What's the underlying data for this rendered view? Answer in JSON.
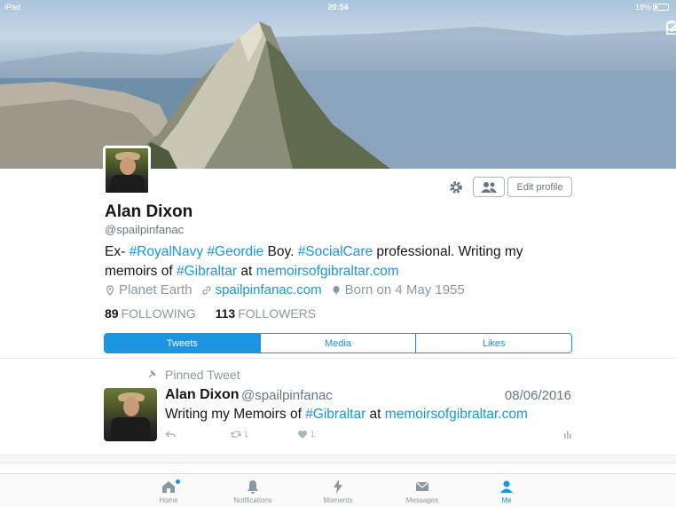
{
  "status_bar": {
    "device": "iPad",
    "time": "20:54",
    "battery": "18%"
  },
  "header": {
    "search_icon": "search-icon",
    "compose_icon": "compose-icon"
  },
  "profile": {
    "name": "Alan Dixon",
    "handle": "@spailpinfanac",
    "bio": {
      "p1": "Ex- ",
      "t1": "#RoyalNavy",
      "p2": " ",
      "t2": "#Geordie",
      "p3": " Boy. ",
      "t3": "#SocialCare",
      "p4": " professional. Writing my memoirs of ",
      "t4": "#Gibraltar",
      "p5": " at ",
      "t5": "memoirsofgibraltar.com"
    },
    "location": "Planet Earth",
    "website": "spailpinfanac.com",
    "born": "Born on 4 May 1955",
    "following_count": "89",
    "following_label": "FOLLOWING",
    "followers_count": "113",
    "followers_label": "FOLLOWERS",
    "edit_label": "Edit profile"
  },
  "tabs": [
    {
      "label": "Tweets",
      "active": true
    },
    {
      "label": "Media",
      "active": false
    },
    {
      "label": "Likes",
      "active": false
    }
  ],
  "tweet": {
    "pinned_label": "Pinned Tweet",
    "name": "Alan Dixon",
    "handle": "@spailpinfanac",
    "date": "08/06/2016",
    "text_prefix": "Writing my Memoirs of ",
    "text_tag": "#Gibraltar",
    "text_mid": " at ",
    "text_link": "memoirsofgibraltar.com",
    "retweets": "1",
    "likes": "1"
  },
  "tabbar": [
    {
      "label": "Home",
      "icon": "home-icon"
    },
    {
      "label": "Notifications",
      "icon": "bell-icon"
    },
    {
      "label": "Moments",
      "icon": "lightning-icon"
    },
    {
      "label": "Messages",
      "icon": "envelope-icon"
    },
    {
      "label": "Me",
      "icon": "person-icon",
      "active": true
    }
  ]
}
